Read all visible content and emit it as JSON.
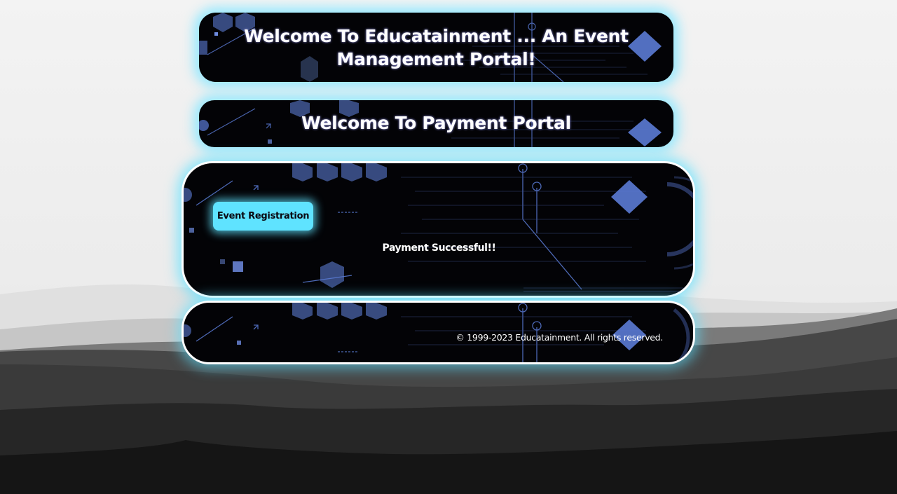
{
  "header": {
    "welcome_title": "Welcome To Educatainment ... An Event Management Portal!"
  },
  "payment_header": {
    "title": "Welcome To Payment Portal"
  },
  "content": {
    "event_registration_button": "Event Registration",
    "status_message": "Payment Successful!!"
  },
  "footer": {
    "copyright": "© 1999-2023 Educatainment. All rights reserved."
  },
  "colors": {
    "accent": "#5fe3ff",
    "glow": "#8ce8ff",
    "panel_background": "#030306",
    "tech_pattern": "#5b7bd5"
  }
}
